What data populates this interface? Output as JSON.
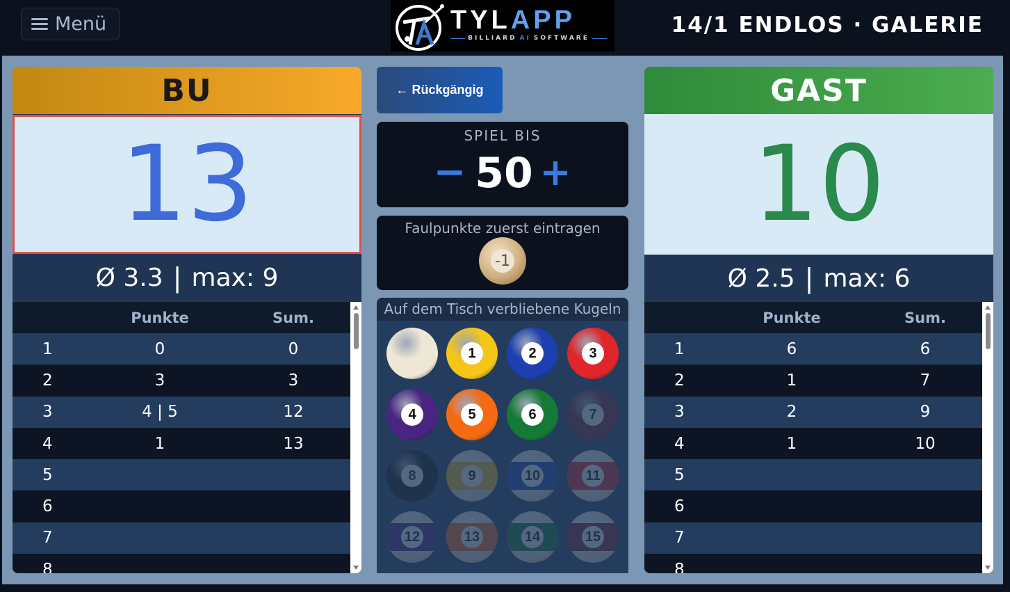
{
  "header": {
    "menu_label": "Menü",
    "logo_brand_a": "TYL",
    "logo_brand_b": "APP",
    "logo_sub_a": "BILLIARD",
    "logo_sub_ai": "AI",
    "logo_sub_b": "SOFTWARE",
    "game_title": "14/1 ENDLOS · GALERIE"
  },
  "colors": {
    "player1_bar": "#f8a92a",
    "player2_bar": "#4cad4f",
    "player1_score": "#3e6bd8",
    "player2_score": "#2a8a4e",
    "accent": "#3b7be0"
  },
  "player1": {
    "name": "BU",
    "score": "13",
    "avg": "Ø 3.3",
    "sep": "|",
    "max": "max: 9",
    "active": true,
    "col_points": "Punkte",
    "col_sum": "Sum.",
    "rows": [
      {
        "n": "1",
        "p": "0",
        "s": "0"
      },
      {
        "n": "2",
        "p": "3",
        "s": "3"
      },
      {
        "n": "3",
        "p": "4 | 5",
        "s": "12"
      },
      {
        "n": "4",
        "p": "1",
        "s": "13"
      },
      {
        "n": "5",
        "p": "",
        "s": ""
      },
      {
        "n": "6",
        "p": "",
        "s": ""
      },
      {
        "n": "7",
        "p": "",
        "s": ""
      },
      {
        "n": "8",
        "p": "",
        "s": ""
      }
    ]
  },
  "player2": {
    "name": "GAST",
    "score": "10",
    "avg": "Ø 2.5",
    "sep": "|",
    "max": "max: 6",
    "active": false,
    "col_points": "Punkte",
    "col_sum": "Sum.",
    "rows": [
      {
        "n": "1",
        "p": "6",
        "s": "6"
      },
      {
        "n": "2",
        "p": "1",
        "s": "7"
      },
      {
        "n": "3",
        "p": "2",
        "s": "9"
      },
      {
        "n": "4",
        "p": "1",
        "s": "10"
      },
      {
        "n": "5",
        "p": "",
        "s": ""
      },
      {
        "n": "6",
        "p": "",
        "s": ""
      },
      {
        "n": "7",
        "p": "",
        "s": ""
      },
      {
        "n": "8",
        "p": "",
        "s": ""
      }
    ]
  },
  "center": {
    "undo_label": "← Rückgängig",
    "target_label": "SPIEL BIS",
    "target_minus": "−",
    "target_value": "50",
    "target_plus": "+",
    "foul_label": "Faulpunkte zuerst eintragen",
    "foul_value": "-1",
    "balls_label": "Auf dem Tisch verbliebene Kugeln",
    "balls": [
      {
        "num": "",
        "color": "#efe7d6",
        "remaining": true
      },
      {
        "num": "1",
        "color": "#f5c518",
        "remaining": true
      },
      {
        "num": "2",
        "color": "#1d3fb0",
        "remaining": true
      },
      {
        "num": "3",
        "color": "#e0262b",
        "remaining": true
      },
      {
        "num": "4",
        "color": "#4a2483",
        "remaining": true
      },
      {
        "num": "5",
        "color": "#f56a12",
        "remaining": true
      },
      {
        "num": "6",
        "color": "#157a35",
        "remaining": true
      },
      {
        "num": "7",
        "color": "#7a2230",
        "remaining": false
      },
      {
        "num": "8",
        "color": "#111111",
        "remaining": false
      },
      {
        "num": "9",
        "color": "#f5c518",
        "remaining": false
      },
      {
        "num": "10",
        "color": "#1d3fb0",
        "remaining": false
      },
      {
        "num": "11",
        "color": "#e0262b",
        "remaining": false
      },
      {
        "num": "12",
        "color": "#4a2483",
        "remaining": false
      },
      {
        "num": "13",
        "color": "#f56a12",
        "remaining": false
      },
      {
        "num": "14",
        "color": "#157a35",
        "remaining": false
      },
      {
        "num": "15",
        "color": "#7a2230",
        "remaining": false
      }
    ]
  }
}
